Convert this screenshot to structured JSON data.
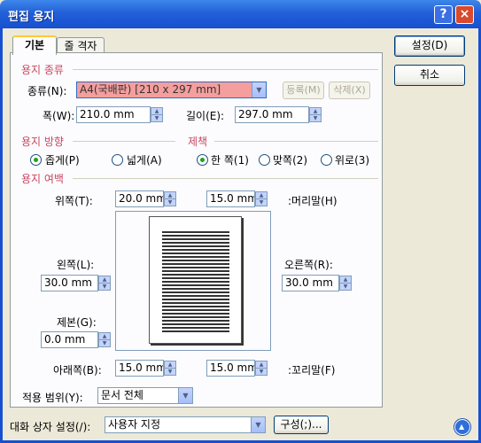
{
  "window": {
    "title": "편집 용지",
    "help": "?",
    "close": "×"
  },
  "tabs": [
    {
      "label": "기본"
    },
    {
      "label": "줄 격자"
    }
  ],
  "buttons": {
    "ok": "설정(D)",
    "cancel": "취소",
    "register": "등록(M)",
    "delete": "삭제(X)",
    "config": "구성(;)..."
  },
  "paper": {
    "section": "용지 종류",
    "type_label": "종류(N):",
    "type_value": "A4(국배판) [210 x 297 mm]",
    "width_label": "폭(W):",
    "width_value": "210.0 mm",
    "length_label": "길이(E):",
    "length_value": "297.0 mm"
  },
  "orientation": {
    "section": "용지 방향",
    "portrait": "좁게(P)",
    "landscape": "넓게(A)",
    "selected": "portrait"
  },
  "binding": {
    "section": "제책",
    "single": "한 쪽(1)",
    "facing": "맞쪽(2)",
    "top": "위로(3)",
    "selected": "single"
  },
  "margins": {
    "section": "용지 여백",
    "top_label": "위쪽(T):",
    "top_value": "20.0 mm",
    "header_value": "15.0 mm",
    "header_label": ":머리말(H)",
    "left_label": "왼쪽(L):",
    "left_value": "30.0 mm",
    "right_label": "오른쪽(R):",
    "right_value": "30.0 mm",
    "gutter_label": "제본(G):",
    "gutter_value": "0.0 mm",
    "bottom_label": "아래쪽(B):",
    "bottom_value": "15.0 mm",
    "footer_value": "15.0 mm",
    "footer_label": ":꼬리말(F)"
  },
  "apply": {
    "label": "적용 범위(Y):",
    "value": "문서 전체"
  },
  "dialog_setting": {
    "label": "대화 상자 설정(/):",
    "value": "사용자 지정"
  },
  "spinner": {
    "up": "▲",
    "down": "▼"
  },
  "dropdown_glyph": "▼"
}
